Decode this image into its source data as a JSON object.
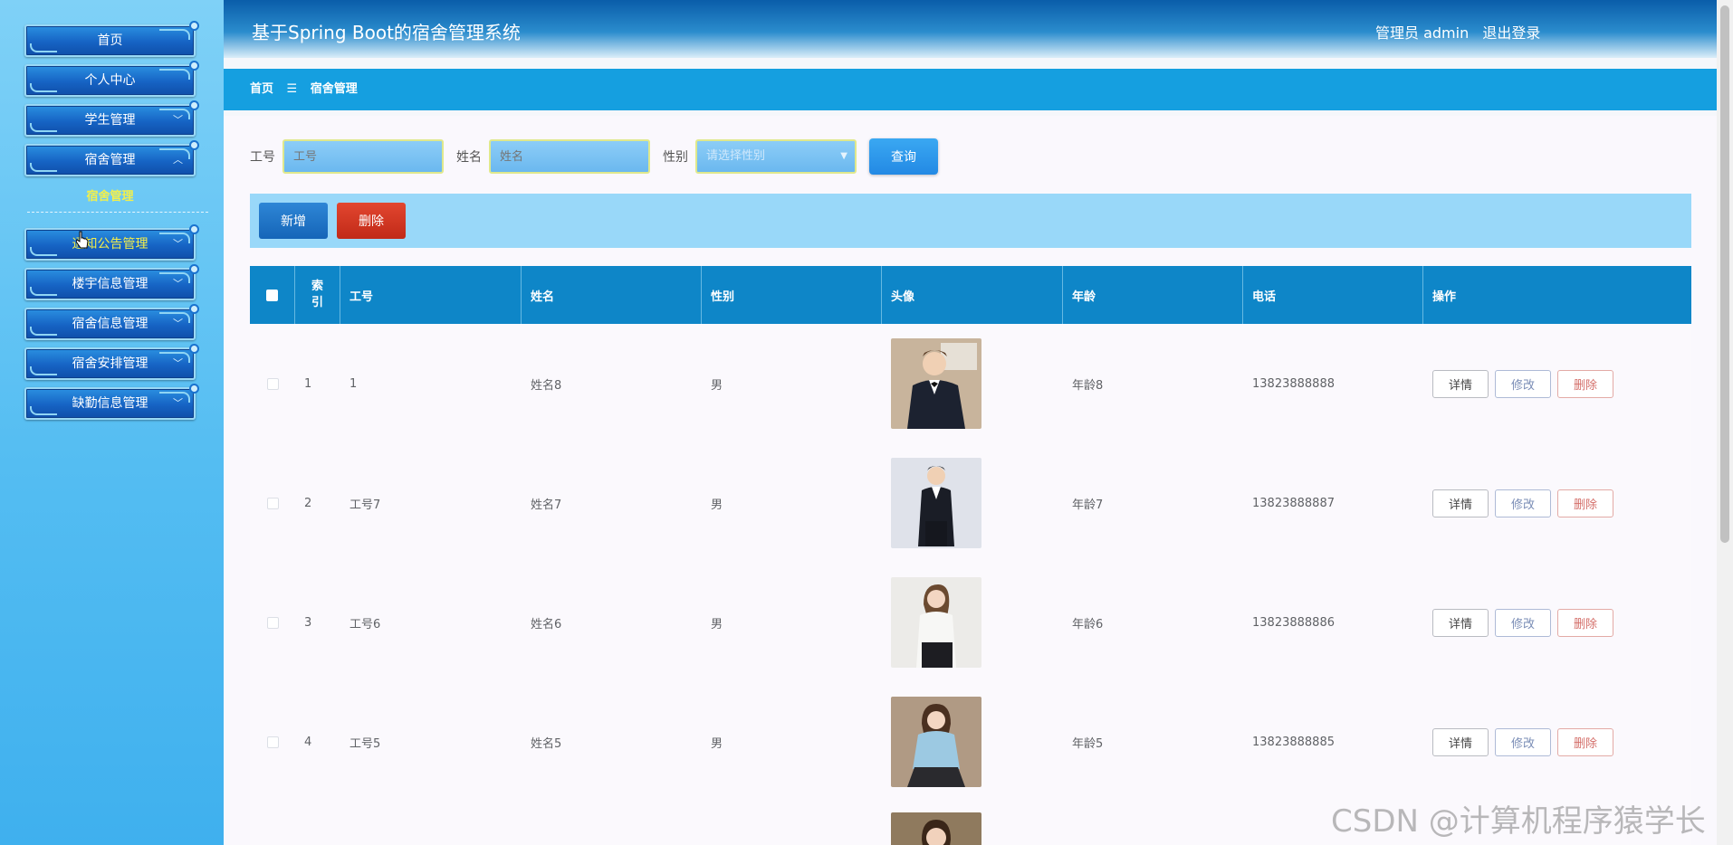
{
  "sidebar": {
    "menu": [
      {
        "label": "首页"
      },
      {
        "label": "个人中心"
      },
      {
        "label": "学生管理"
      },
      {
        "label": "宿舍管理"
      },
      {
        "label": "通知公告管理"
      },
      {
        "label": "楼宇信息管理"
      },
      {
        "label": "宿舍信息管理"
      },
      {
        "label": "宿舍安排管理"
      },
      {
        "label": "缺勤信息管理"
      }
    ],
    "sub_item": "宿舍管理"
  },
  "header": {
    "title": "基于Spring Boot的宿舍管理系统",
    "role": "管理员 admin",
    "logout": "退出登录"
  },
  "breadcrumb": {
    "home": "首页",
    "separator": "☰",
    "current": "宿舍管理"
  },
  "search": {
    "job_no_label": "工号",
    "job_no_placeholder": "工号",
    "name_label": "姓名",
    "name_placeholder": "姓名",
    "gender_label": "性别",
    "gender_placeholder": "请选择性别",
    "query_button": "查询"
  },
  "actions": {
    "add": "新增",
    "delete": "删除"
  },
  "table": {
    "columns": [
      "",
      "索引",
      "工号",
      "姓名",
      "性别",
      "头像",
      "年龄",
      "电话",
      "操作"
    ],
    "rows": [
      {
        "index": "1",
        "job_no": "1",
        "name": "姓名8",
        "gender": "男",
        "age": "年龄8",
        "phone": "13823888888"
      },
      {
        "index": "2",
        "job_no": "工号7",
        "name": "姓名7",
        "gender": "男",
        "age": "年龄7",
        "phone": "13823888887"
      },
      {
        "index": "3",
        "job_no": "工号6",
        "name": "姓名6",
        "gender": "男",
        "age": "年龄6",
        "phone": "13823888886"
      },
      {
        "index": "4",
        "job_no": "工号5",
        "name": "姓名5",
        "gender": "男",
        "age": "年龄5",
        "phone": "13823888885"
      }
    ],
    "row_actions": {
      "detail": "详情",
      "edit": "修改",
      "delete": "删除"
    }
  },
  "watermark": "CSDN @计算机程序猿学长",
  "colors": {
    "sidebar_bg": "#54bdf2",
    "header_dark": "#0a5da9",
    "breadcrumb_bg": "#159fe0",
    "table_header": "#0e86c8",
    "action_bar": "#99d8f9",
    "accent_yellow": "#f4ee4a",
    "danger": "#c12a18"
  }
}
